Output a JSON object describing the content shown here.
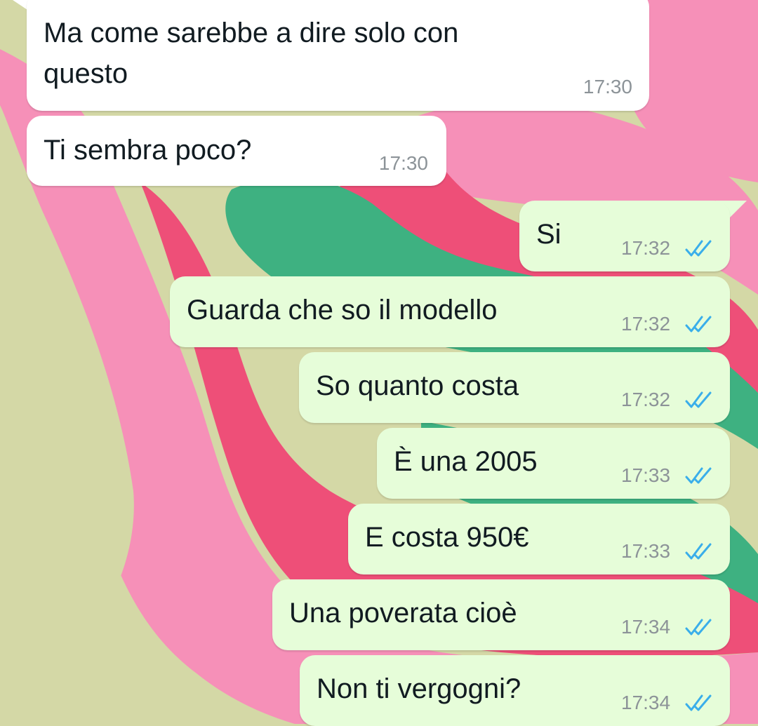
{
  "theme": {
    "wallpaper_base": "#d4d8a6",
    "wallpaper_pink_light": "#f690b8",
    "wallpaper_pink_dark": "#ee4f78",
    "wallpaper_green": "#3eb181",
    "incoming_bubble": "#ffffff",
    "outgoing_bubble": "#e6fdd9",
    "read_ticks": "#3aaeea"
  },
  "messages": [
    {
      "direction": "incoming",
      "text": "Ma come sarebbe a dire solo con\nquesto",
      "time": "17:30"
    },
    {
      "direction": "incoming",
      "text": "Ti sembra poco?",
      "time": "17:30"
    },
    {
      "direction": "outgoing",
      "text": "Si",
      "time": "17:32",
      "status": "read",
      "status_icon": "double-check-icon"
    },
    {
      "direction": "outgoing",
      "text": "Guarda che so il modello",
      "time": "17:32",
      "status": "read",
      "status_icon": "double-check-icon"
    },
    {
      "direction": "outgoing",
      "text": "So quanto costa",
      "time": "17:32",
      "status": "read",
      "status_icon": "double-check-icon"
    },
    {
      "direction": "outgoing",
      "text": "È una 2005",
      "time": "17:33",
      "status": "read",
      "status_icon": "double-check-icon"
    },
    {
      "direction": "outgoing",
      "text": "E costa 950€",
      "time": "17:33",
      "status": "read",
      "status_icon": "double-check-icon"
    },
    {
      "direction": "outgoing",
      "text": "Una poverata cioè",
      "time": "17:34",
      "status": "read",
      "status_icon": "double-check-icon"
    },
    {
      "direction": "outgoing",
      "text": "Non ti vergogni?",
      "time": "17:34",
      "status": "read",
      "status_icon": "double-check-icon"
    }
  ]
}
